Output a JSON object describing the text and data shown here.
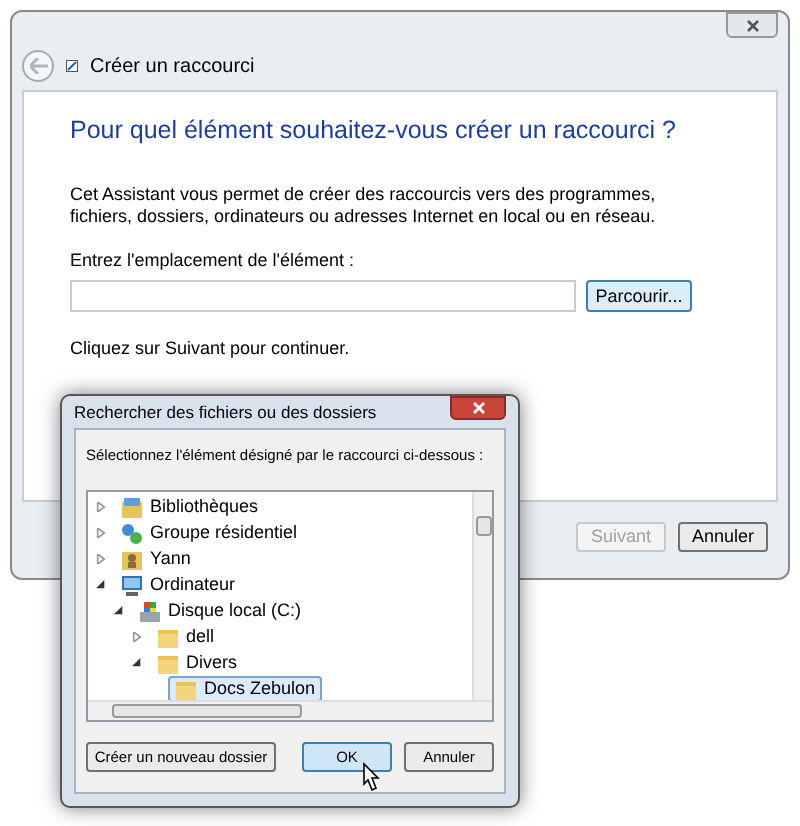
{
  "window": {
    "title": "Créer un raccourci"
  },
  "heading": "Pour quel élément souhaitez-vous créer un raccourci ?",
  "description": "Cet Assistant vous permet de créer des raccourcis vers des programmes, fichiers, dossiers, ordinateurs ou adresses Internet en local ou en réseau.",
  "location_label": "Entrez l'emplacement de l'élément :",
  "browse_button": "Parcourir...",
  "hint": "Cliquez sur Suivant pour continuer.",
  "buttons": [
    {
      "label": "Suivant",
      "disabled": true
    },
    {
      "label": "Annuler",
      "disabled": false
    }
  ],
  "dialog": {
    "title": "Rechercher des fichiers ou des dossiers",
    "instruction": "Sélectionnez l'élément désigné par le raccourci ci-dessous :",
    "tree": [
      {
        "label": "Bibliothèques",
        "kind": "library",
        "expanded": false,
        "selected": false
      },
      {
        "label": "Groupe résidentiel",
        "kind": "homegroup",
        "expanded": false,
        "selected": false
      },
      {
        "label": "Yann",
        "kind": "user",
        "expanded": false,
        "selected": false
      },
      {
        "label": "Ordinateur",
        "kind": "computer",
        "expanded": true,
        "selected": false,
        "children": [
          {
            "label": "Disque local (C:)",
            "kind": "drive",
            "expanded": true,
            "selected": false,
            "children": [
              {
                "label": "dell",
                "kind": "folder",
                "expanded": false,
                "selected": false
              },
              {
                "label": "Divers",
                "kind": "folder",
                "expanded": true,
                "selected": false,
                "children": [
                  {
                    "label": "Docs Zebulon",
                    "kind": "folder",
                    "expanded": false,
                    "selected": true,
                    "leaf": true
                  }
                ]
              }
            ]
          }
        ]
      }
    ],
    "buttons": [
      {
        "label": "Créer un nouveau dossier",
        "default": false
      },
      {
        "label": "OK",
        "default": true
      },
      {
        "label": "Annuler",
        "default": false
      }
    ]
  }
}
